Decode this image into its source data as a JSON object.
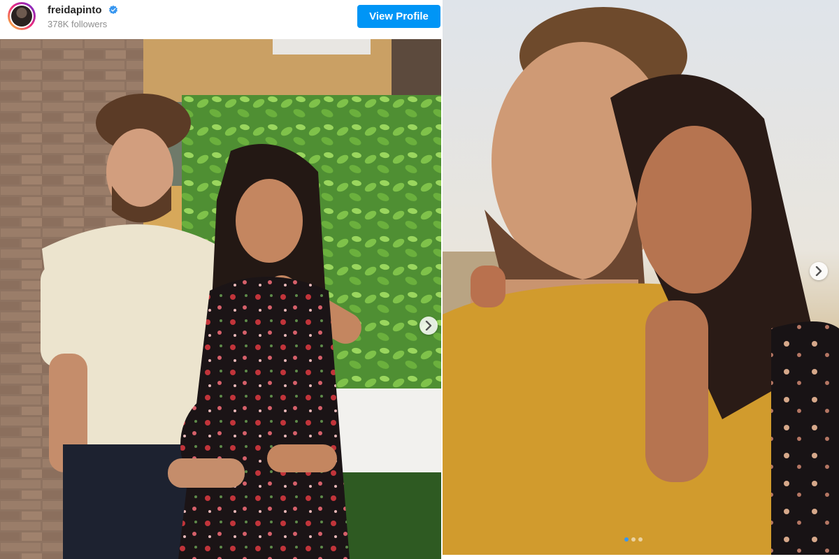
{
  "profile": {
    "username": "freidapinto",
    "followers": "378K followers",
    "view_profile_label": "View Profile",
    "verified_icon": "verified-badge-icon",
    "verified_color": "#3897f0"
  },
  "carousel": {
    "next_icon": "chevron-right-icon",
    "dots_total": 3,
    "dots_active": 1,
    "accent": "#0095f6"
  }
}
